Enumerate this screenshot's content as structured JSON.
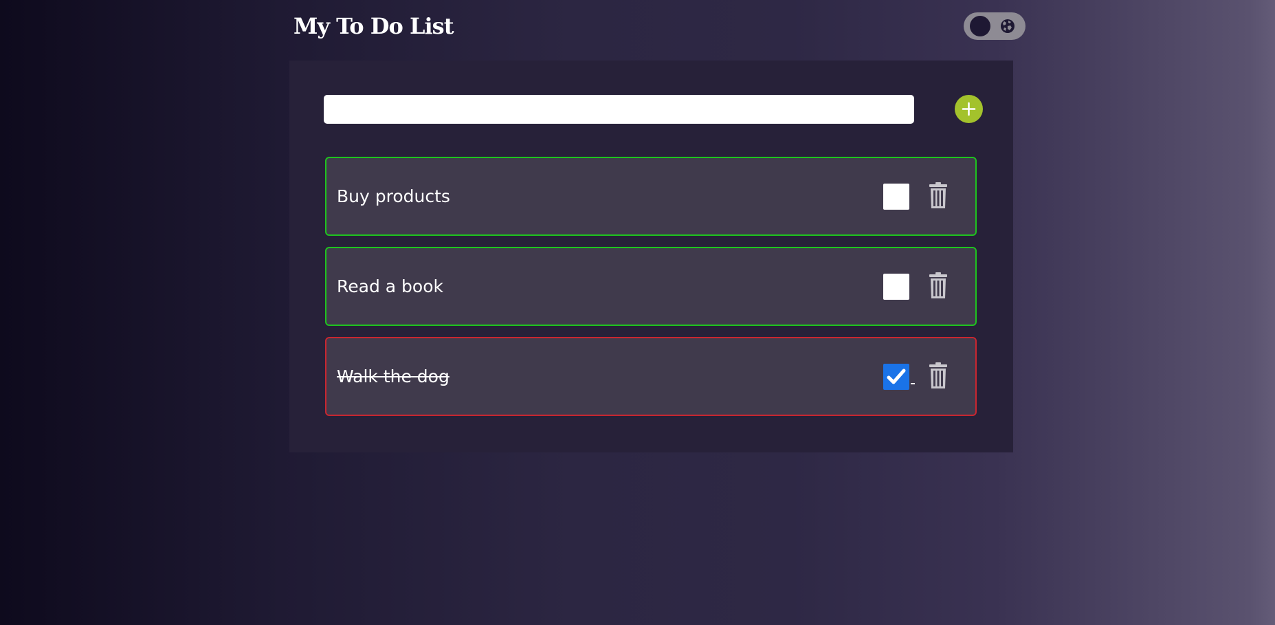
{
  "app": {
    "title": "My To Do List"
  },
  "theme_toggle": {
    "state": "dark",
    "icon": "globe-icon"
  },
  "new_task": {
    "value": "",
    "placeholder": "",
    "add_icon": "plus-icon"
  },
  "tasks": [
    {
      "label": "Buy products",
      "completed": false
    },
    {
      "label": "Read a book",
      "completed": false
    },
    {
      "label": "Walk the dog",
      "completed": true
    }
  ],
  "colors": {
    "accent_add": "#a3c22c",
    "active_border": "#1ec41e",
    "completed_border": "#c92630",
    "checkbox_checked": "#1a73e8"
  }
}
